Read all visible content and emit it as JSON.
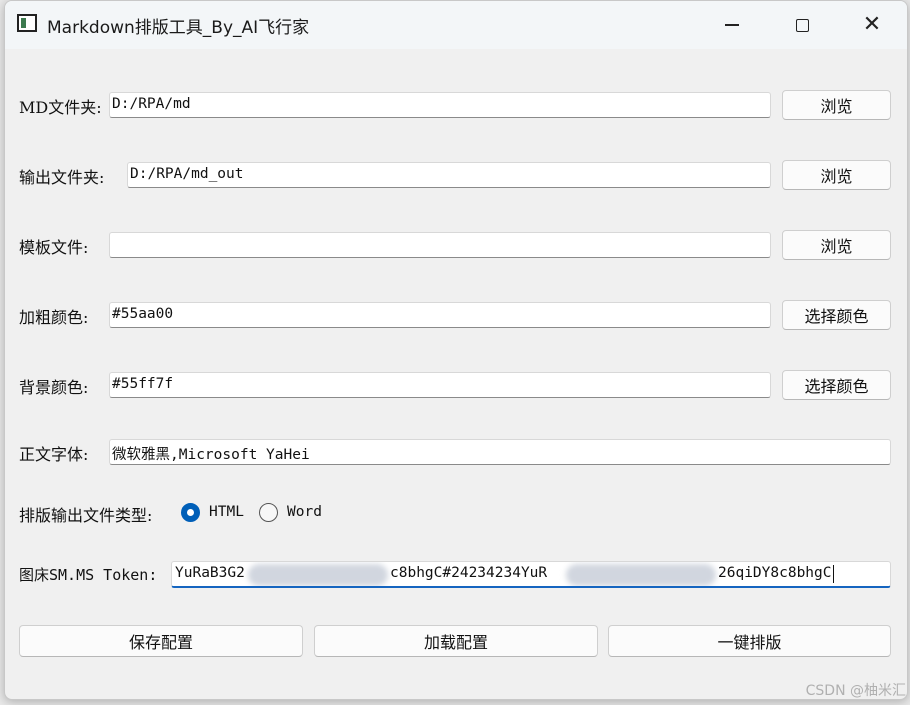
{
  "window": {
    "title": "Markdown排版工具_By_AI飞行家",
    "close_glyph": "✕"
  },
  "form": {
    "md_folder": {
      "label": "MD文件夹:",
      "value": "D:/RPA/md",
      "button": "浏览"
    },
    "output_folder": {
      "label": "输出文件夹:",
      "value": "D:/RPA/md_out",
      "button": "浏览"
    },
    "template_file": {
      "label": "模板文件:",
      "value": "",
      "button": "浏览"
    },
    "bold_color": {
      "label": "加粗颜色:",
      "value": "#55aa00",
      "button": "选择颜色"
    },
    "background_color": {
      "label": "背景颜色:",
      "value": "#55ff7f",
      "button": "选择颜色"
    },
    "body_font": {
      "label": "正文字体:",
      "value": "微软雅黑,Microsoft YaHei"
    },
    "output_type": {
      "label": "排版输出文件类型:",
      "options": [
        {
          "label": "HTML",
          "checked": true
        },
        {
          "label": "Word",
          "checked": false
        }
      ]
    },
    "token": {
      "label": "图床SM.MS Token:",
      "segment_1": "YuRaB3G2",
      "segment_2": "c8bhgC#24234234YuR",
      "segment_3": "26qiDY8c8bhgC"
    }
  },
  "actions": {
    "save": "保存配置",
    "load": "加载配置",
    "format": "一键排版"
  },
  "watermark": "CSDN @柚米汇",
  "colors": {
    "accent": "#005fb8",
    "focus_underline": "#1565c0",
    "window_bg": "#f0f0f0"
  }
}
